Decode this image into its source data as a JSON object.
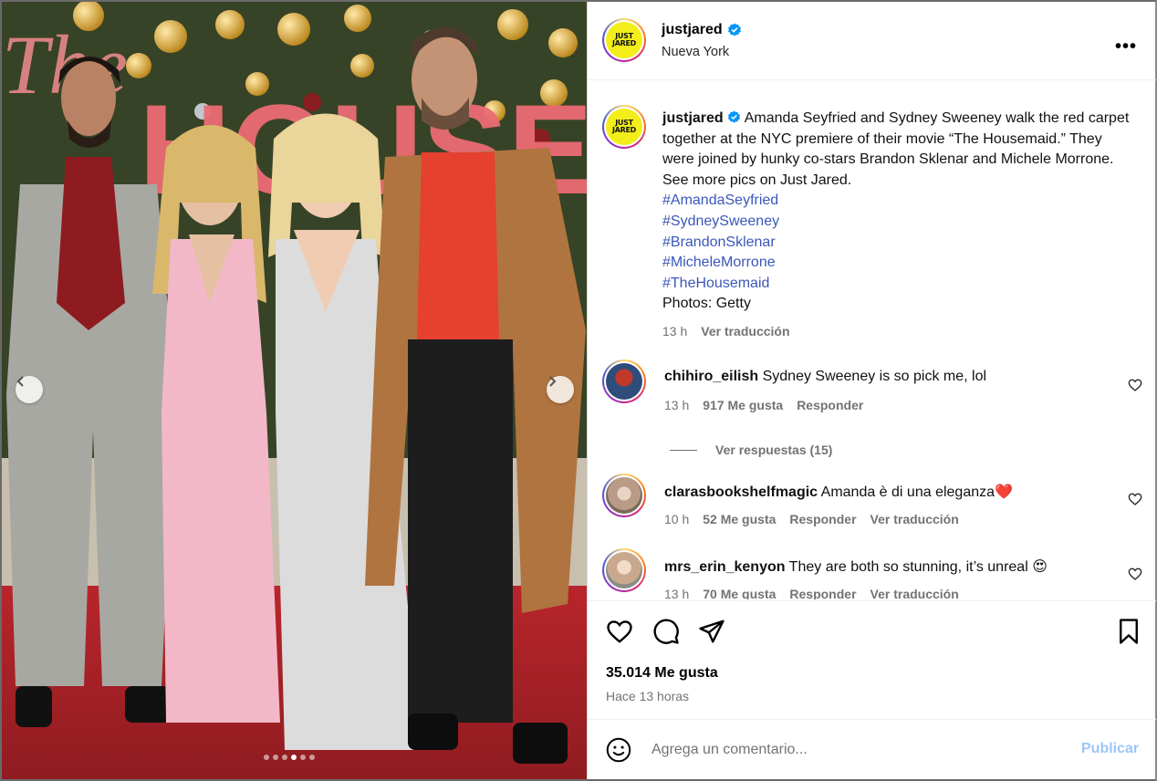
{
  "post": {
    "username": "justjared",
    "location": "Nueva York",
    "logo_line1": "JUST",
    "logo_line2": "JARED",
    "more_label": "•••"
  },
  "caption": {
    "username": "justjared",
    "text": "Amanda Seyfried and Sydney Sweeney walk the red carpet together at the NYC premiere of their movie “The Housemaid.” They were joined by hunky co-stars Brandon Sklenar and Michele Morrone. See more pics on Just Jared.",
    "hashtags": [
      "#AmandaSeyfried",
      "#SydneySweeney",
      "#BrandonSklenar",
      "#MicheleMorrone",
      "#TheHousemaid"
    ],
    "credit": "Photos: Getty",
    "time": "13 h",
    "translate": "Ver traducción"
  },
  "comments": [
    {
      "username": "chihiro_eilish",
      "text": "Sydney Sweeney is so pick me, lol",
      "time": "13 h",
      "likes": "917 Me gusta",
      "reply": "Responder",
      "avatar_color": "#5b7fae"
    },
    {
      "username": "clarasbookshelfmagic",
      "text": "Amanda è di una eleganza❤️",
      "time": "10 h",
      "likes": "52 Me gusta",
      "reply": "Responder",
      "translate": "Ver traducción",
      "avatar_color": "#b99b87"
    },
    {
      "username": "mrs_erin_kenyon",
      "text": "They are both so stunning, it’s unreal 😍",
      "time": "13 h",
      "likes": "70 Me gusta",
      "reply": "Responder",
      "translate": "Ver traducción",
      "avatar_color": "#c9a98d"
    }
  ],
  "view_replies": "Ver respuestas (15)",
  "engagement": {
    "likes": "35.014 Me gusta",
    "posted": "Hace 13 horas"
  },
  "composer": {
    "placeholder": "Agrega un comentario...",
    "publish": "Publicar"
  },
  "media": {
    "slide_count": 6,
    "active_slide": 3
  },
  "colors": {
    "link": "#3b57b8",
    "muted": "#737373",
    "publish_disabled": "#9ec5f7",
    "verified": "#0095f6"
  }
}
